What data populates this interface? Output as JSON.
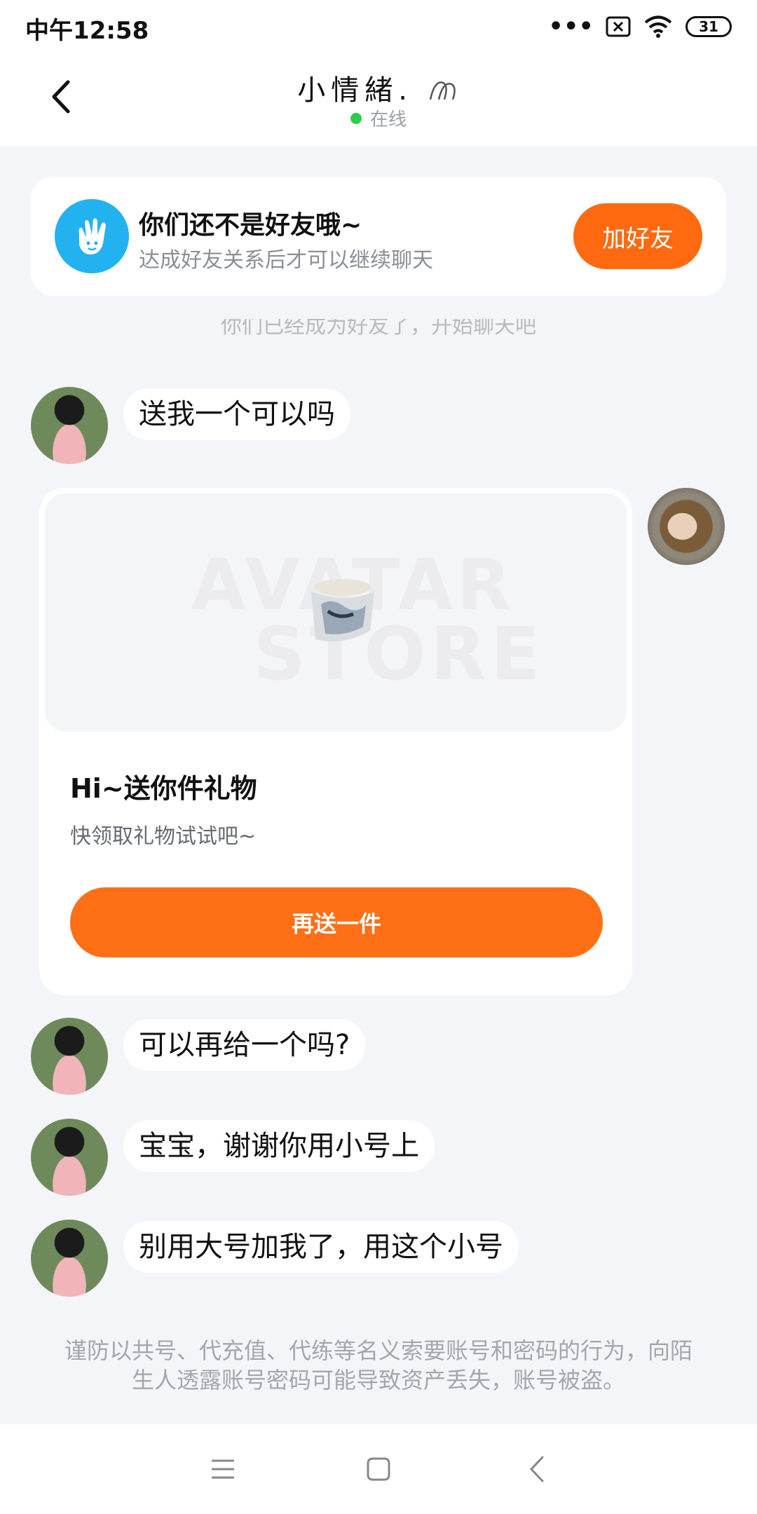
{
  "status_bar": {
    "time": "中午12:58",
    "battery": "31",
    "icons": [
      "more-dots-icon",
      "sim-x-icon",
      "wifi-icon",
      "battery-icon"
    ]
  },
  "header": {
    "title": "小情緒.",
    "status": "在线",
    "status_color": "#2ecb4a"
  },
  "friend_banner": {
    "title": "你们还不是好友哦~",
    "subtitle": "达成好友关系后才可以继续聊天",
    "button": "加好友",
    "accent": "#ff6a10"
  },
  "system_note": "你们已经成为好友了，开始聊天吧",
  "messages": [
    {
      "text": "送我一个可以吗"
    },
    {
      "text": "可以再给一个吗?"
    },
    {
      "text": "宝宝，谢谢你用小号上"
    },
    {
      "text": "别用大号加我了，用这个小号"
    }
  ],
  "gift_card": {
    "watermark_line1": "AVATAR",
    "watermark_line2": "STORE",
    "title": "Hi~送你件礼物",
    "subtitle": "快领取礼物试试吧~",
    "button": "再送一件",
    "accent": "#ff6f15"
  },
  "footer_warning": "谨防以共号、代充值、代练等名义索要账号和密码的行为，向陌生人透露账号密码可能导致资产丢失，账号被盗。",
  "nav": {
    "icons": [
      "menu-icon",
      "home-square-icon",
      "back-triangle-icon"
    ]
  }
}
